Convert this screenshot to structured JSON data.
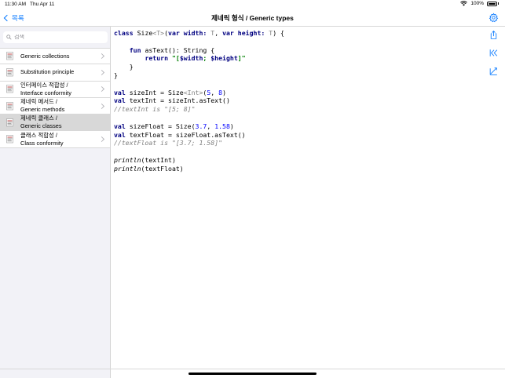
{
  "status": {
    "time": "11:30 AM",
    "date": "Thu Apr 11",
    "battery": "100%"
  },
  "nav": {
    "back_label": "목록",
    "title": "제네릭 형식 / Generic types"
  },
  "search": {
    "placeholder": "검색"
  },
  "sidebar": {
    "items": [
      {
        "line1": "Generic collections",
        "line2": ""
      },
      {
        "line1": "Substitution principle",
        "line2": ""
      },
      {
        "line1": "인터페이스 적합성 /",
        "line2": "Interface conformity"
      },
      {
        "line1": "제네릭 메서드 /",
        "line2": "Generic methods"
      },
      {
        "line1": "제네릭 클래스 /",
        "line2": "Generic classes"
      },
      {
        "line1": "클래스 적합성 /",
        "line2": "Class conformity"
      }
    ],
    "selected_index": 4
  },
  "code": {
    "l1_class": "class",
    "l1_name": " Size",
    "l1_generic": "<T>",
    "l1_open": "(",
    "l1_var1": "var",
    "l1_width": " width: ",
    "l1_T1": "T",
    "l1_comma": ", ",
    "l1_var2": "var",
    "l1_height": " height: ",
    "l1_T2": "T",
    "l1_close": ") {",
    "l3_fun": "fun",
    "l3_rest": " asText(): String {",
    "l4_return": "return",
    "l4_q1": " \"[",
    "l4_w": "$width",
    "l4_sep": "; ",
    "l4_h": "$height",
    "l4_q2": "]\"",
    "l5": "    }",
    "l6": "}",
    "l8_val": "val",
    "l8_a": " sizeInt = Size",
    "l8_gen": "<Int>",
    "l8_b": "(",
    "l8_n1": "5",
    "l8_c": ", ",
    "l8_n2": "8",
    "l8_d": ")",
    "l9_val": "val",
    "l9_rest": " textInt = sizeInt.asText()",
    "l10_cmt": "//textInt is \"[5; 8]\"",
    "l12_val": "val",
    "l12_a": " sizeFloat = Size(",
    "l12_n1": "3.7",
    "l12_c": ", ",
    "l12_n2": "1.58",
    "l12_d": ")",
    "l13_val": "val",
    "l13_rest": " textFloat = sizeFloat.asText()",
    "l14_cmt": "//textFloat is \"[3.7; 1.58]\"",
    "l16_fn": "println",
    "l16_rest": "(textInt)",
    "l17_fn": "println",
    "l17_rest": "(textFloat)"
  },
  "icons": {
    "accent": "#0a7aff",
    "tools": [
      "share-icon",
      "collapse-icon",
      "edit-icon"
    ],
    "settings": "gear-icon"
  }
}
